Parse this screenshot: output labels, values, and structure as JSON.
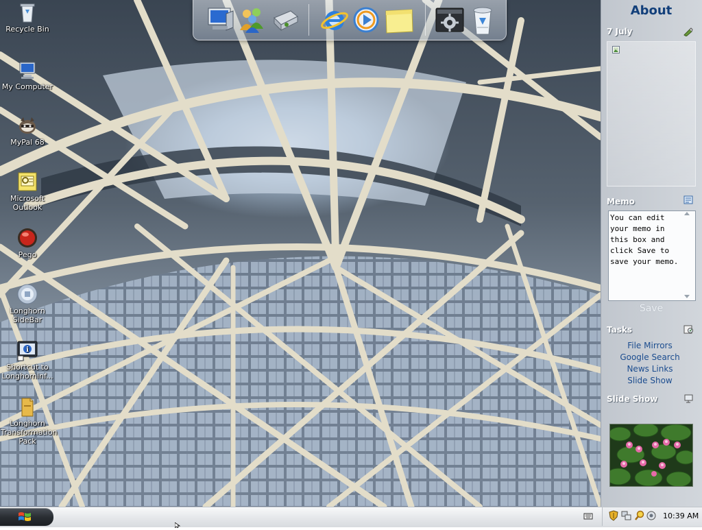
{
  "desktop": {
    "icons": [
      {
        "label": "Recycle Bin",
        "icon": "recycle-bin-icon"
      },
      {
        "label": "My Computer",
        "icon": "computer-icon"
      },
      {
        "label": "MyPal 68",
        "icon": "raccoon-icon"
      },
      {
        "label": "Microsoft Outlook",
        "icon": "outlook-icon"
      },
      {
        "label": "Pego",
        "icon": "red-orb-icon"
      },
      {
        "label": "Longhorn SideBar",
        "icon": "sidebar-icon"
      },
      {
        "label": "Shortcut to Longhorninf...",
        "icon": "info-shortcut-icon"
      },
      {
        "label": "Longhorn Transformation Pack",
        "icon": "folder-icon"
      }
    ]
  },
  "dock": {
    "items": [
      {
        "icon": "my-computer-icon"
      },
      {
        "icon": "users-icon"
      },
      {
        "icon": "network-drive-icon"
      },
      {
        "icon": "internet-explorer-icon"
      },
      {
        "icon": "media-player-icon"
      },
      {
        "icon": "notes-icon"
      },
      {
        "icon": "control-panel-icon"
      },
      {
        "icon": "recycle-bin-icon"
      }
    ]
  },
  "sidebar": {
    "title": "About",
    "calendar": {
      "date": "7 July"
    },
    "memo": {
      "title": "Memo",
      "text": "You can edit your memo in this box and click Save to save your memo.",
      "save_label": "Save"
    },
    "tasks": {
      "title": "Tasks",
      "items": [
        "File Mirrors",
        "Google Search",
        "News Links",
        "Slide Show"
      ]
    },
    "slideshow": {
      "title": "Slide Show"
    }
  },
  "taskbar": {
    "clock": "10:39 AM"
  },
  "colors": {
    "sidebar_title": "#123f7a",
    "task_link": "#1c4d8f",
    "start_button": "#2a2e33"
  }
}
